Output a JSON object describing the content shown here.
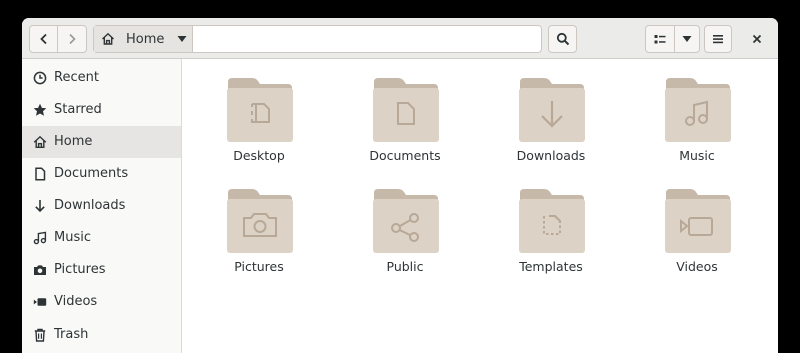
{
  "headerbar": {
    "path_label": "Home"
  },
  "sidebar": {
    "items": [
      {
        "label": "Recent",
        "icon": "recent-icon"
      },
      {
        "label": "Starred",
        "icon": "star-icon"
      },
      {
        "label": "Home",
        "icon": "home-icon",
        "active": true
      },
      {
        "label": "Documents",
        "icon": "document-icon"
      },
      {
        "label": "Downloads",
        "icon": "download-icon"
      },
      {
        "label": "Music",
        "icon": "music-icon"
      },
      {
        "label": "Pictures",
        "icon": "camera-icon"
      },
      {
        "label": "Videos",
        "icon": "video-icon"
      },
      {
        "label": "Trash",
        "icon": "trash-icon"
      }
    ]
  },
  "folders": [
    {
      "label": "Desktop",
      "icon": "desktop-emblem"
    },
    {
      "label": "Documents",
      "icon": "document-emblem"
    },
    {
      "label": "Downloads",
      "icon": "download-emblem"
    },
    {
      "label": "Music",
      "icon": "music-emblem"
    },
    {
      "label": "Pictures",
      "icon": "camera-emblem"
    },
    {
      "label": "Public",
      "icon": "share-emblem"
    },
    {
      "label": "Templates",
      "icon": "template-emblem"
    },
    {
      "label": "Videos",
      "icon": "video-emblem"
    }
  ],
  "colors": {
    "folder_body": "#ddd2c6",
    "folder_tab": "#c6b9aa",
    "emblem": "#b7a897",
    "headerbar": "#ebebea",
    "sidebar_active": "#e6e5e3"
  }
}
